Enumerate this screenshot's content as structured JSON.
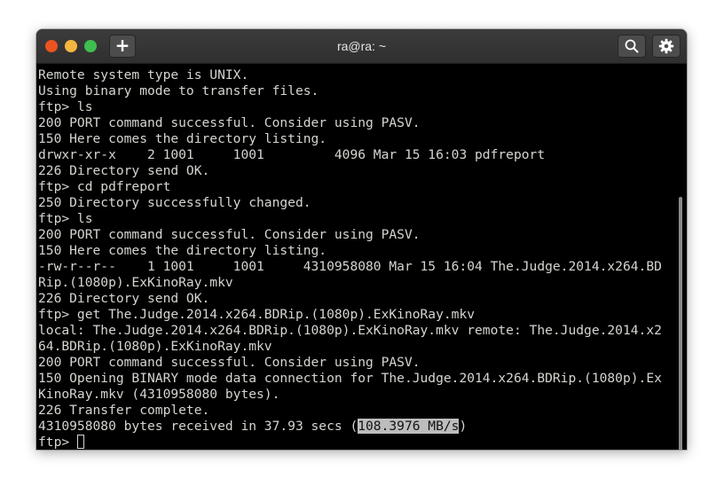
{
  "window": {
    "title": "ra@ra: ~",
    "new_tab_label": "+",
    "controls": [
      "close",
      "minimize",
      "maximize"
    ]
  },
  "header_icons": {
    "search": "search-icon",
    "settings": "gear-icon"
  },
  "colors": {
    "titlebar": "#333333",
    "terminal_bg": "#000000",
    "terminal_fg": "#d3d7cf",
    "close": "#e95420",
    "minimize": "#f4b63f",
    "maximize": "#3fbf51",
    "highlight_bg": "#bdbdbd"
  },
  "terminal": {
    "lines": [
      "Remote system type is UNIX.",
      "Using binary mode to transfer files.",
      "ftp> ls",
      "200 PORT command successful. Consider using PASV.",
      "150 Here comes the directory listing.",
      "drwxr-xr-x    2 1001     1001         4096 Mar 15 16:03 pdfreport",
      "226 Directory send OK.",
      "ftp> cd pdfreport",
      "250 Directory successfully changed.",
      "ftp> ls",
      "200 PORT command successful. Consider using PASV.",
      "150 Here comes the directory listing.",
      "-rw-r--r--    1 1001     1001     4310958080 Mar 15 16:04 The.Judge.2014.x264.BD",
      "Rip.(1080p).ExKinoRay.mkv",
      "226 Directory send OK.",
      "ftp> get The.Judge.2014.x264.BDRip.(1080p).ExKinoRay.mkv",
      "local: The.Judge.2014.x264.BDRip.(1080p).ExKinoRay.mkv remote: The.Judge.2014.x2",
      "64.BDRip.(1080p).ExKinoRay.mkv",
      "200 PORT command successful. Consider using PASV.",
      "150 Opening BINARY mode data connection for The.Judge.2014.x264.BDRip.(1080p).Ex",
      "KinoRay.mkv (4310958080 bytes).",
      "226 Transfer complete."
    ],
    "transfer_line": {
      "prefix": "4310958080 bytes received in 37.93 secs (",
      "rate": "108.3976 MB/s",
      "suffix": ")"
    },
    "prompt": "ftp> "
  }
}
